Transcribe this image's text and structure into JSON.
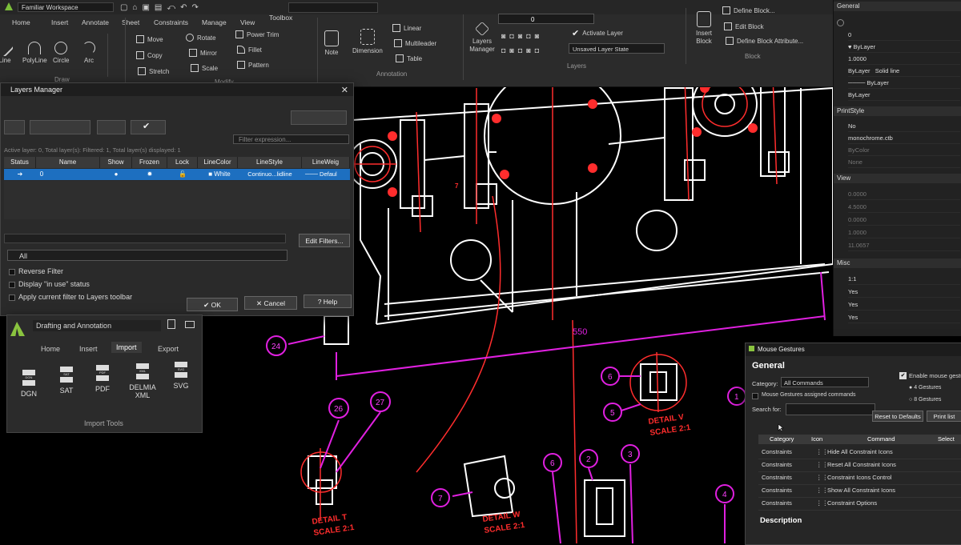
{
  "app": {
    "workspace": "Familiar Workspace",
    "layer_dropdown_value": "0"
  },
  "ribbon": {
    "tabs": [
      "Home",
      "Insert",
      "Annotate",
      "Sheet",
      "Constraints",
      "Manage",
      "View",
      "Toolbox"
    ],
    "active_tab": "Home",
    "draw": {
      "label": "Draw",
      "tools": [
        "Line",
        "PolyLine",
        "Circle",
        "Arc"
      ]
    },
    "modify": {
      "label": "Modify",
      "tools": [
        "Move",
        "Rotate",
        "Copy",
        "Mirror",
        "Stretch",
        "Scale",
        "Power Trim",
        "Fillet",
        "Pattern"
      ]
    },
    "annotation": {
      "label": "Annotation",
      "tools": [
        "Note",
        "Dimension",
        "Linear",
        "Multileader",
        "Table"
      ]
    },
    "layers": {
      "label": "Layers",
      "manager": "Layers Manager",
      "activate": "Activate Layer",
      "state": "Unsaved Layer State"
    },
    "block": {
      "label": "Block",
      "insert": "Insert Block",
      "define": "Define Block...",
      "edit": "Edit Block",
      "define_attr": "Define Block Attribute..."
    }
  },
  "properties": {
    "general_title": "General",
    "general": [
      "0",
      "ByLayer",
      "1.0000",
      "ByLayer",
      "ByLayer",
      "ByLayer"
    ],
    "solid_line": "Solid line",
    "print_title": "PrintStyle",
    "print": [
      "No",
      "monochrome.ctb",
      "ByColor",
      "None"
    ],
    "view_title": "View",
    "view": [
      "0.0000",
      "4.5000",
      "0.0000",
      "1.0000",
      "11.0657"
    ],
    "misc_title": "Misc",
    "misc": [
      "1:1",
      "Yes",
      "Yes",
      "Yes"
    ]
  },
  "layers_dialog": {
    "title": "Layers Manager",
    "filter_placeholder": "Filter expression...",
    "status_line": "Active layer: 0, Total layer(s): Filtered: 1, Total layer(s) displayed: 1",
    "columns": [
      "Status",
      "Name",
      "Show",
      "Frozen",
      "Lock",
      "LineColor",
      "LineStyle",
      "LineWeig"
    ],
    "row": {
      "name": "0",
      "color": "White",
      "style": "Continuo...lidline",
      "weight": "Defaul"
    },
    "edit_filters": "Edit Filters...",
    "filter_value": "All",
    "options": [
      "Reverse Filter",
      "Display \"in use\" status",
      "Apply current filter to Layers toolbar"
    ],
    "buttons": {
      "ok": "OK",
      "cancel": "Cancel",
      "help": "Help"
    }
  },
  "import_panel": {
    "workspace": "Drafting and Annotation",
    "tabs": [
      "Home",
      "Insert",
      "Import",
      "Export"
    ],
    "active_tab": "Import",
    "files": [
      {
        "label": "DGN",
        "tag": "DGN"
      },
      {
        "label": "SAT",
        "tag": "SAT"
      },
      {
        "label": "PDF",
        "tag": "PDF"
      },
      {
        "label": "DELMIA XML",
        "tag": "XML"
      },
      {
        "label": "SVG",
        "tag": "SVG"
      }
    ],
    "group_label": "Import Tools"
  },
  "mouse_gestures": {
    "title": "Mouse Gestures",
    "general": "General",
    "category_label": "Category:",
    "category_value": "All Commands",
    "assigned_only": "Mouse Gestures assigned commands",
    "search_label": "Search for:",
    "enable": "Enable mouse gestu",
    "gesture_opts": [
      "4 Gestures",
      "8 Gestures"
    ],
    "reset": "Reset to Defaults",
    "print_list": "Print list",
    "columns": [
      "Category",
      "Icon",
      "Command",
      "Select"
    ],
    "rows": [
      [
        "Constraints",
        "Hide All Constraint Icons"
      ],
      [
        "Constraints",
        "Reset All Constraint Icons"
      ],
      [
        "Constraints",
        "Constraint Icons Control"
      ],
      [
        "Constraints",
        "Show All Constraint Icons"
      ],
      [
        "Constraints",
        "Constraint Options"
      ]
    ],
    "description": "Description"
  },
  "drawing": {
    "balloons": [
      "24",
      "26",
      "27",
      "6",
      "5",
      "1",
      "6",
      "2",
      "3",
      "4",
      "7",
      "7"
    ],
    "dimension": "550",
    "details": [
      "DETAIL V\nSCALE 2:1",
      "DETAIL T\nSCALE 2:1",
      "DETAIL W\nSCALE 2:1"
    ]
  }
}
